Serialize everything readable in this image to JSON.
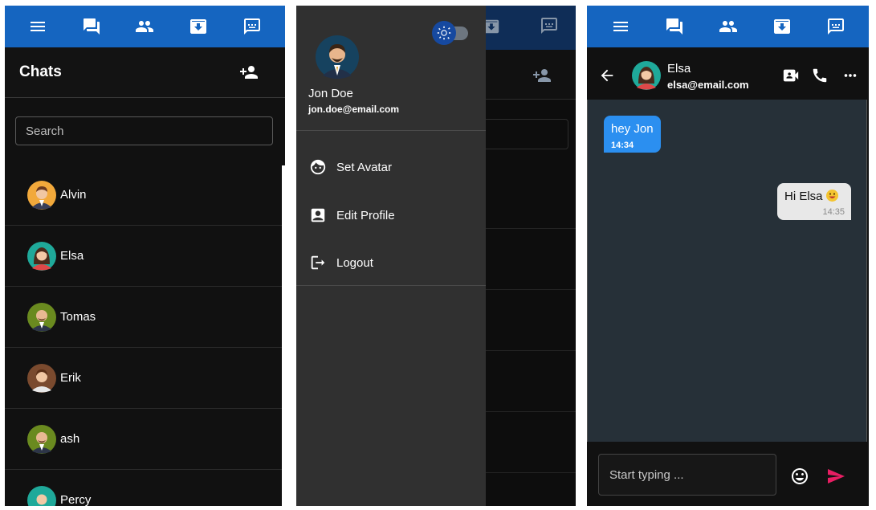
{
  "colors": {
    "primary": "#1565c0",
    "send": "#e91e63",
    "incoming_bubble": "#2b8ff0"
  },
  "nav_icons": [
    "menu-icon",
    "chats-icon",
    "people-icon",
    "archive-icon",
    "chat-bubble-icon"
  ],
  "chat_list": {
    "title": "Chats",
    "search_placeholder": "Search",
    "contacts": [
      {
        "name": "Alvin",
        "avatar": "avatar-alvin"
      },
      {
        "name": "Elsa",
        "avatar": "avatar-elsa"
      },
      {
        "name": "Tomas",
        "avatar": "avatar-tomas"
      },
      {
        "name": "Erik",
        "avatar": "avatar-erik"
      },
      {
        "name": "ash",
        "avatar": "avatar-ash"
      },
      {
        "name": "Percy",
        "avatar": "avatar-percy"
      }
    ]
  },
  "drawer": {
    "user_name": "Jon Doe",
    "user_email": "jon.doe@email.com",
    "menu": [
      {
        "label": "Set Avatar",
        "icon": "face-icon"
      },
      {
        "label": "Edit Profile",
        "icon": "contact-card-icon"
      },
      {
        "label": "Logout",
        "icon": "logout-icon"
      }
    ]
  },
  "chat": {
    "contact_name": "Elsa",
    "contact_email": "elsa@email.com",
    "messages": [
      {
        "text": "hey Jon",
        "time": "14:34",
        "direction": "incoming"
      },
      {
        "text": "Hi Elsa",
        "time": "14:35",
        "direction": "outgoing",
        "emoji": "grinning-face"
      }
    ],
    "input_placeholder": "Start typing ..."
  }
}
